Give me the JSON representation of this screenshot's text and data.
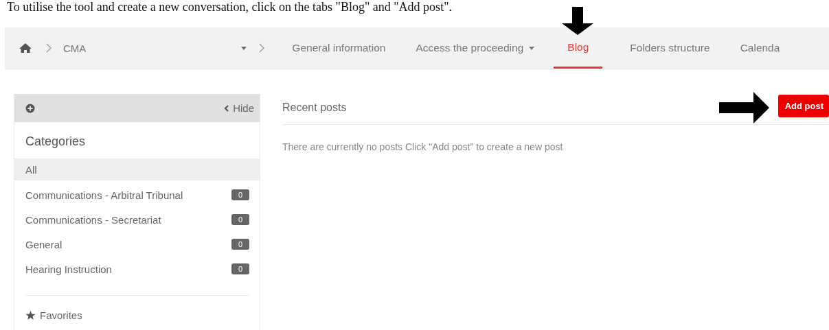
{
  "caption": "To utilise the tool and create a new conversation, click on the tabs \"Blog\" and \"Add post\".",
  "breadcrumb": {
    "items": [
      "CMA"
    ]
  },
  "tabs": [
    {
      "label": "General information",
      "selected": false,
      "dropdown": false,
      "pointer": false
    },
    {
      "label": "Access the proceeding",
      "selected": false,
      "dropdown": true,
      "pointer": false
    },
    {
      "label": "Blog",
      "selected": true,
      "dropdown": false,
      "pointer": true
    },
    {
      "label": "Folders structure",
      "selected": false,
      "dropdown": false,
      "pointer": false
    },
    {
      "label": "Calenda",
      "selected": false,
      "dropdown": false,
      "pointer": false
    }
  ],
  "sidebar": {
    "hide_label": "Hide",
    "title": "Categories",
    "categories": [
      {
        "name": "All",
        "selected": true
      },
      {
        "name": "Communications - Arbitral Tribunal",
        "count": "0",
        "selected": false
      },
      {
        "name": "Communications - Secretariat",
        "count": "0",
        "selected": false
      },
      {
        "name": "General",
        "count": "0",
        "selected": false
      },
      {
        "name": "Hearing Instruction",
        "count": "0",
        "selected": false
      }
    ],
    "favorites": "Favorites"
  },
  "main": {
    "title": "Recent posts",
    "empty_message": "There are currently no posts Click \"Add post\" to create a new post",
    "add_button": "Add post",
    "add_pointer": true
  }
}
